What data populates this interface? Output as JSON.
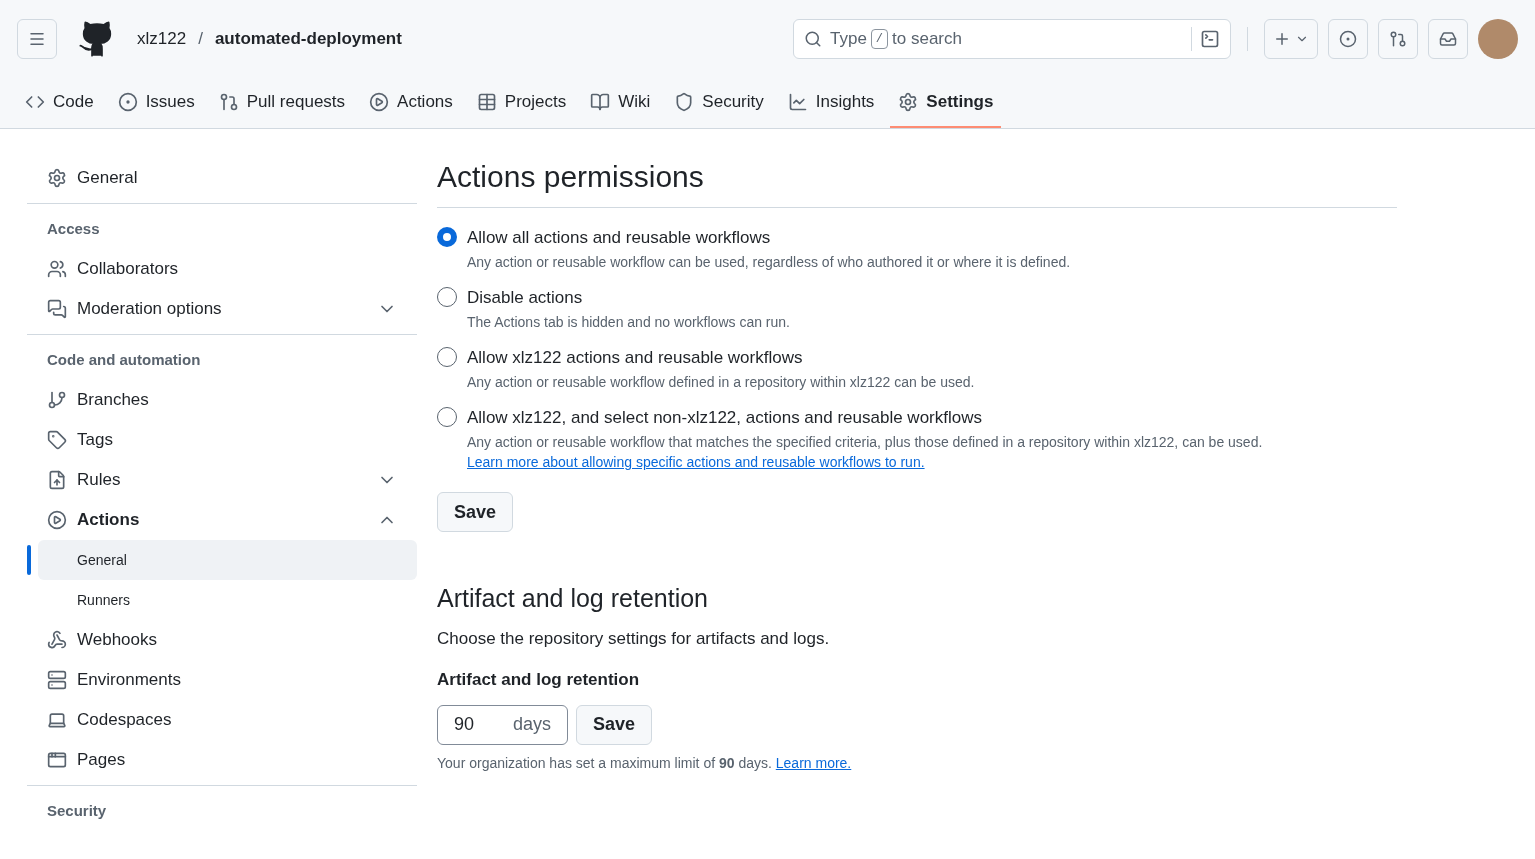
{
  "header": {
    "owner": "xlz122",
    "separator": "/",
    "repo": "automated-deployment",
    "search": {
      "before": "Type",
      "key": "/",
      "after": "to search"
    }
  },
  "tabs": [
    {
      "label": "Code",
      "selected": false
    },
    {
      "label": "Issues",
      "selected": false
    },
    {
      "label": "Pull requests",
      "selected": false
    },
    {
      "label": "Actions",
      "selected": false
    },
    {
      "label": "Projects",
      "selected": false
    },
    {
      "label": "Wiki",
      "selected": false
    },
    {
      "label": "Security",
      "selected": false
    },
    {
      "label": "Insights",
      "selected": false
    },
    {
      "label": "Settings",
      "selected": true
    }
  ],
  "sidebar": {
    "sections": [
      {
        "items": [
          {
            "label": "General"
          }
        ]
      },
      {
        "heading": "Access",
        "items": [
          {
            "label": "Collaborators"
          },
          {
            "label": "Moderation options",
            "expanded": false
          }
        ]
      },
      {
        "heading": "Code and automation",
        "items": [
          {
            "label": "Branches"
          },
          {
            "label": "Tags"
          },
          {
            "label": "Rules",
            "expanded": false
          },
          {
            "label": "Actions",
            "expanded": true,
            "children": [
              {
                "label": "General",
                "selected": true
              },
              {
                "label": "Runners",
                "selected": false
              }
            ]
          },
          {
            "label": "Webhooks"
          },
          {
            "label": "Environments"
          },
          {
            "label": "Codespaces"
          },
          {
            "label": "Pages"
          }
        ]
      },
      {
        "heading": "Security"
      }
    ]
  },
  "permissions": {
    "title": "Actions permissions",
    "options": [
      {
        "label": "Allow all actions and reusable workflows",
        "description": "Any action or reusable workflow can be used, regardless of who authored it or where it is defined.",
        "selected": true
      },
      {
        "label": "Disable actions",
        "description": "The Actions tab is hidden and no workflows can run.",
        "selected": false
      },
      {
        "label": "Allow xlz122 actions and reusable workflows",
        "description": "Any action or reusable workflow defined in a repository within xlz122 can be used.",
        "selected": false
      },
      {
        "label": "Allow xlz122, and select non-xlz122, actions and reusable workflows",
        "description": "Any action or reusable workflow that matches the specified criteria, plus those defined in a repository within xlz122, can be used.",
        "link": "Learn more about allowing specific actions and reusable workflows to run.",
        "selected": false
      }
    ],
    "save": "Save"
  },
  "retention": {
    "title": "Artifact and log retention",
    "description": "Choose the repository settings for artifacts and logs.",
    "label": "Artifact and log retention",
    "value": "90",
    "unit": "days",
    "save": "Save",
    "note": "Your organization has set a maximum limit of **90** days.",
    "link": "Learn more."
  }
}
